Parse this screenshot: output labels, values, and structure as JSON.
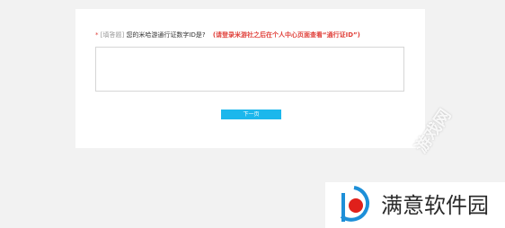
{
  "survey": {
    "required_mark": "*",
    "question_type": "[填答题]",
    "question_text": "您的米哈游通行证数字ID是?",
    "hint": "(请登录米游社之后在个人中心页面查看“通行证ID”)",
    "answer_value": "",
    "next_label": "下一页"
  },
  "watermark": {
    "diagonal_text": "游戏网",
    "brand_text": "满意软件园"
  },
  "colors": {
    "accent": "#1cb7ec",
    "required": "#e0403a",
    "background": "#f2f2f2"
  }
}
